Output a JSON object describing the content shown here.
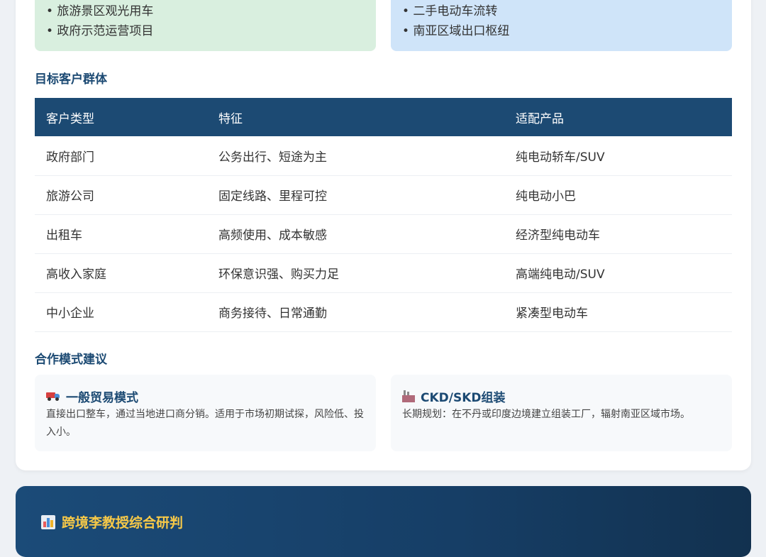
{
  "scenarios": {
    "left_items": [
      "• 旅游景区观光用车",
      "• 政府示范运营项目"
    ],
    "right_items": [
      "• 二手电动车流转",
      "• 南亚区域出口枢纽"
    ]
  },
  "customers": {
    "title": "目标客户群体",
    "headers": [
      "客户类型",
      "特征",
      "适配产品"
    ],
    "rows": [
      [
        "政府部门",
        "公务出行、短途为主",
        "纯电动轿车/SUV"
      ],
      [
        "旅游公司",
        "固定线路、里程可控",
        "纯电动小巴"
      ],
      [
        "出租车",
        "高频使用、成本敏感",
        "经济型纯电动车"
      ],
      [
        "高收入家庭",
        "环保意识强、购买力足",
        "高端纯电动/SUV"
      ],
      [
        "中小企业",
        "商务接待、日常通勤",
        "紧凑型电动车"
      ]
    ]
  },
  "cooperation": {
    "title": "合作模式建议",
    "modes": [
      {
        "icon": "truck-icon",
        "title": "一般贸易模式",
        "desc": "直接出口整车，通过当地进口商分销。适用于市场初期试探，风险低、投入小。"
      },
      {
        "icon": "factory-icon",
        "title": "CKD/SKD组装",
        "desc": "长期规划：在不丹或印度边境建立组装工厂，辐射南亚区域市场。"
      }
    ]
  },
  "analysis": {
    "icon": "bar-chart-icon",
    "title": "跨境李教授综合研判"
  },
  "colors": {
    "primary": "#1c4a73",
    "accent_gold": "#f7c948",
    "green_box": "#d9efdf",
    "blue_box": "#cfe4f9"
  }
}
